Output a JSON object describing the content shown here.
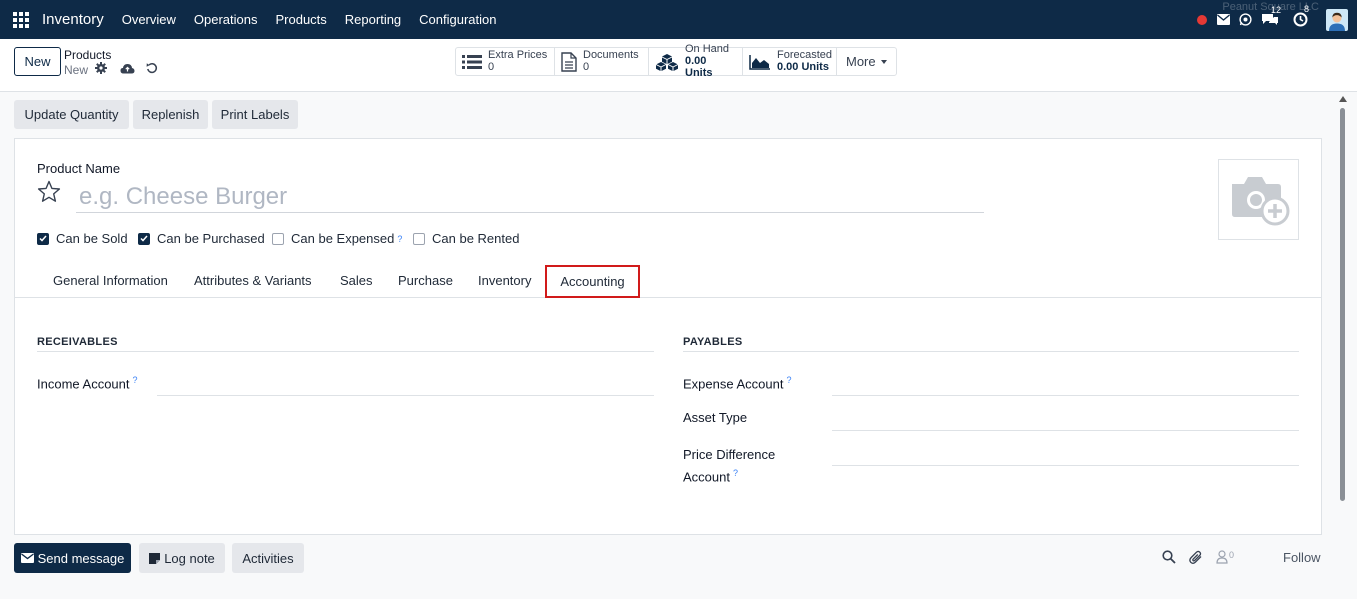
{
  "navbar": {
    "brand": "Inventory",
    "menu": [
      "Overview",
      "Operations",
      "Products",
      "Reporting",
      "Configuration"
    ],
    "company": "Peanut Square LLC",
    "messages_count": "12",
    "activities_count": "8",
    "colors": {
      "bg": "#0e2a47",
      "status_dot": "#e53935"
    }
  },
  "control": {
    "new_label": "New",
    "breadcrumb": "Products",
    "record": "New",
    "smart_buttons": [
      {
        "icon": "list-icon",
        "label": "Extra Prices",
        "value": "0"
      },
      {
        "icon": "document-icon",
        "label": "Documents",
        "value": "0"
      },
      {
        "icon": "cubes-icon",
        "label": "On Hand",
        "value": "0.00 Units"
      },
      {
        "icon": "area-chart-icon",
        "label": "Forecasted",
        "value": "0.00 Units"
      }
    ],
    "more_label": "More"
  },
  "actions": [
    "Update Quantity",
    "Replenish",
    "Print Labels"
  ],
  "form": {
    "name_label": "Product Name",
    "name_placeholder": "e.g. Cheese Burger",
    "checkboxes": [
      {
        "label": "Can be Sold",
        "checked": true
      },
      {
        "label": "Can be Purchased",
        "checked": true
      },
      {
        "label": "Can be Expensed",
        "checked": false,
        "help": "?"
      },
      {
        "label": "Can be Rented",
        "checked": false
      }
    ],
    "tabs": [
      "General Information",
      "Attributes & Variants",
      "Sales",
      "Purchase",
      "Inventory",
      "Accounting"
    ],
    "active_tab": "Accounting",
    "receivables": {
      "title": "RECEIVABLES",
      "income_account": "Income Account",
      "help": "?"
    },
    "payables": {
      "title": "PAYABLES",
      "expense_account": "Expense Account",
      "asset_type": "Asset Type",
      "price_diff_line1": "Price Difference",
      "price_diff_line2": "Account",
      "help": "?"
    }
  },
  "chatter": {
    "send_message": "Send message",
    "log_note": "Log note",
    "activities": "Activities",
    "followers_count": "0",
    "follow": "Follow"
  }
}
